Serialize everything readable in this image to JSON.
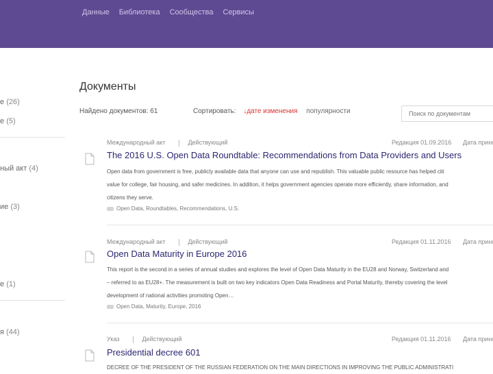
{
  "nav": {
    "items": [
      "Данные",
      "Библиотека",
      "Сообщества",
      "Сервисы"
    ]
  },
  "sidebar": {
    "items": [
      {
        "label": "е",
        "count": "(26)"
      },
      {
        "label": "е",
        "count": "(5)"
      },
      {
        "label": "ный акт",
        "count": "(4)"
      },
      {
        "label": "ие",
        "count": "(3)"
      },
      {
        "label": "е",
        "count": "(1)"
      },
      {
        "label": "я",
        "count": "(44)"
      }
    ]
  },
  "main": {
    "title": "Документы",
    "found_label": "Найдено документов: 61",
    "sort_label": "Сортировать:",
    "sort_arrow": "↓",
    "sort_active": "дате изменения",
    "sort_other": "популярности",
    "search_placeholder": "Поиск по документам"
  },
  "documents": [
    {
      "type": "Международный акт",
      "status": "Действующий",
      "edited": "Редакция 01.09.2016",
      "accepted": "Дата приня",
      "title": "The 2016 U.S. Open Data Roundtable: Recommendations from Data Providers and Users",
      "description": [
        "Open data from government is free, publicly available data that anyone can use and republish. This valuable public resource has helped citi",
        "value for college, fair housing, and safer medicines. In addition, it helps government agencies operate more efficiently, share information, and",
        "citizens they serve."
      ],
      "tags": "Open Data, Roundtables, Recommendations, U.S."
    },
    {
      "type": "Международный акт",
      "status": "Действующий",
      "edited": "Редакция 01.11.2016",
      "accepted": "Дата приня",
      "title": "Open Data Maturity in Europe 2016",
      "description": [
        "This report is the second in a series of annual studies and explores the level of Open Data Maturity in the EU28 and Norway, Switzerland and",
        "– referred to as EU28+. The measurement is built on two key indicators Open Data Readiness and Portal Maturity, thereby covering the level",
        "development of national activities promoting Open…"
      ],
      "tags": "Open Data, Maturity, Europe, 2016"
    },
    {
      "type": "Указ",
      "status": "Действующий",
      "edited": "Редакция 01.11.2016",
      "accepted": "Дата приня",
      "title": "Presidential decree 601",
      "description": [
        "DECREE OF THE PRESIDENT OF THE RUSSIAN FEDERATION ON THE MAIN DIRECTIONS IN IMPROVING THE PUBLIC ADMINISTRATI"
      ],
      "tags": ""
    }
  ]
}
